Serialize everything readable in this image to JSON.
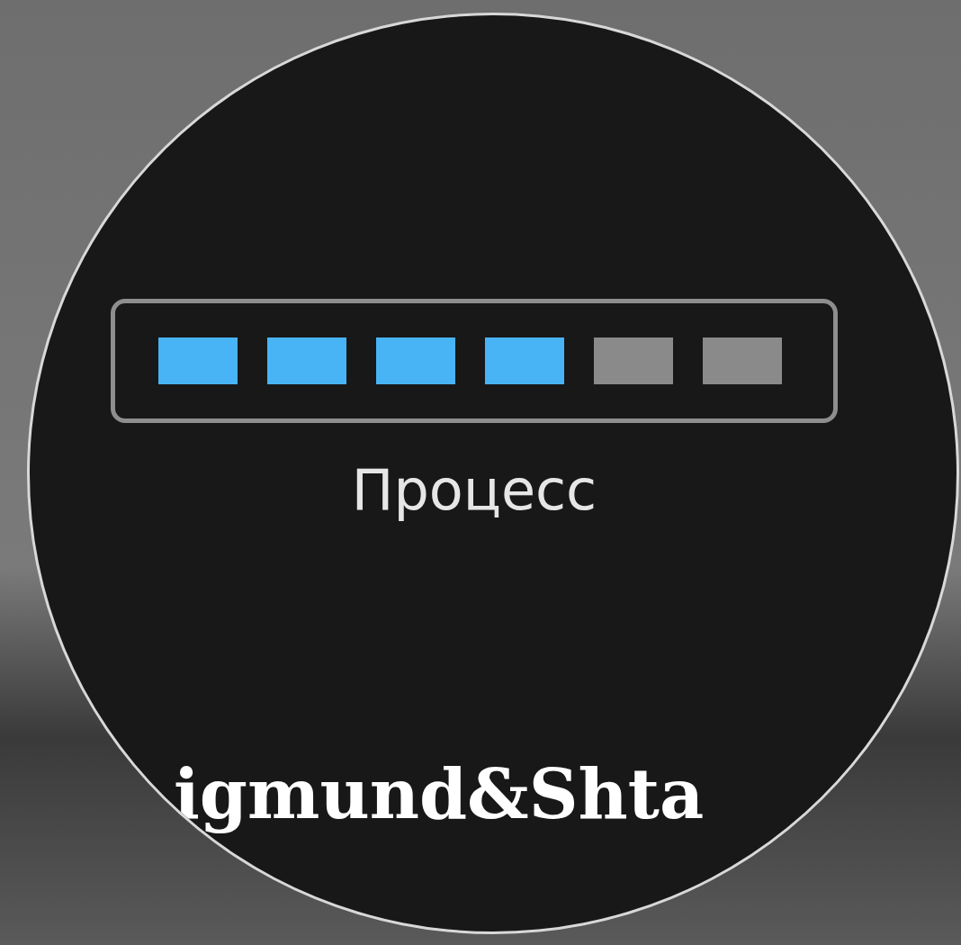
{
  "display": {
    "progress": {
      "segments": [
        {
          "on": true
        },
        {
          "on": true
        },
        {
          "on": true
        },
        {
          "on": true
        },
        {
          "on": false
        },
        {
          "on": false
        }
      ]
    },
    "status_label": "Процесс"
  },
  "brand_logo": "igmund&Shta"
}
